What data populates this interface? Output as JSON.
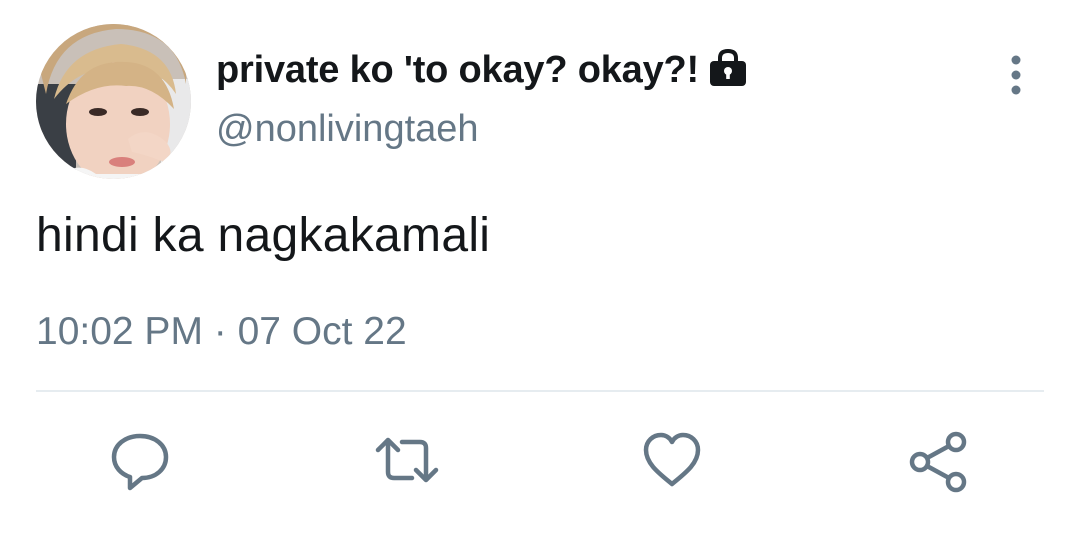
{
  "tweet": {
    "display_name": "private ko 'to okay? okay?!",
    "handle": "@nonlivingtaeh",
    "text": "hindi ka nagkakamali",
    "timestamp": "10:02 PM · 07 Oct 22",
    "protected_account": true
  },
  "actions": {
    "reply_icon": "comment-icon",
    "retweet_icon": "retweet-icon",
    "like_icon": "heart-icon",
    "share_icon": "share-icon"
  },
  "colors": {
    "primary_text": "#14171a",
    "secondary_text": "#657786",
    "icon": "#657786",
    "divider": "#e6ecf0"
  }
}
